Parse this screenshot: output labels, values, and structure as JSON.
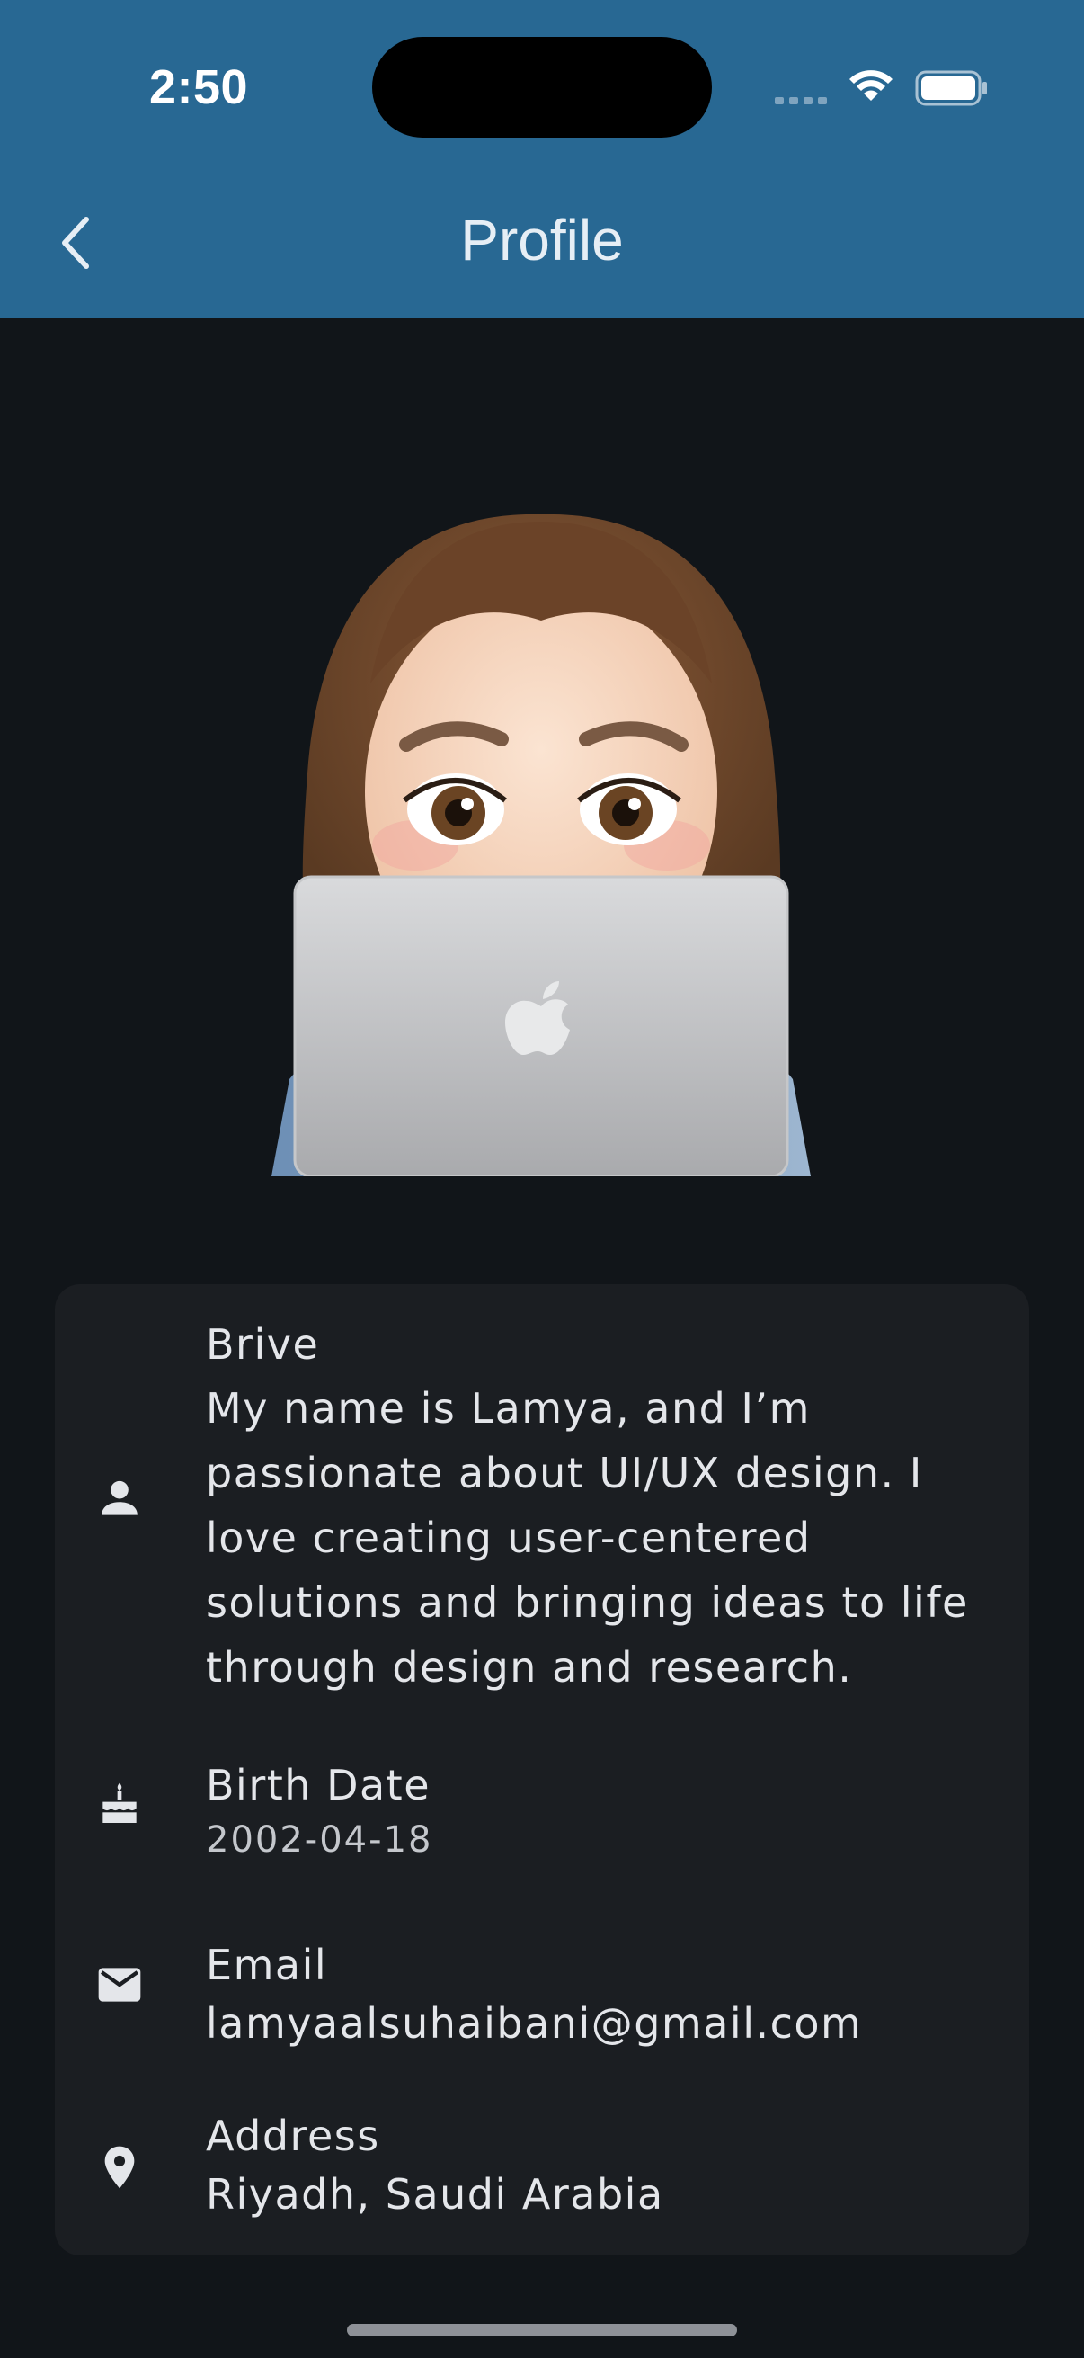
{
  "status_bar": {
    "time": "2:50"
  },
  "header": {
    "title": "Profile"
  },
  "icons": {
    "back": "chevron-left-icon",
    "bio": "person-icon",
    "birth_date": "cake-icon",
    "email": "mail-icon",
    "address": "location-pin-icon"
  },
  "profile": {
    "bio_label": "Brive",
    "bio_value": "My name is Lamya, and I’m passionate about UI/UX design. I love creating user-centered solutions and bringing ideas to life through design and research.",
    "birth_date_label": "Birth Date",
    "birth_date_value": "2002-04-18",
    "email_label": "Email",
    "email_value": "lamyaalsuhaibani@gmail.com",
    "address_label": "Address",
    "address_value": "Riyadh, Saudi Arabia"
  },
  "colors": {
    "header_bg": "#286893",
    "page_bg": "#111519",
    "card_bg": "#1b1e22",
    "text": "#e4e6ea"
  }
}
